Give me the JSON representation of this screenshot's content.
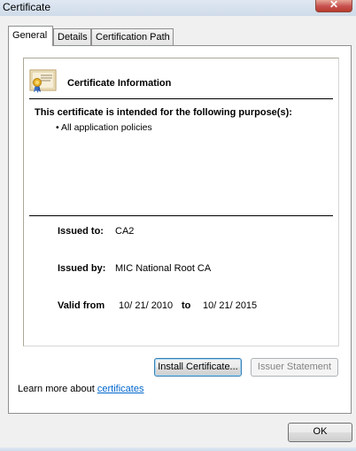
{
  "window": {
    "title": "Certificate",
    "close_symbol": "✕"
  },
  "tabs": [
    {
      "label": "General",
      "active": true
    },
    {
      "label": "Details",
      "active": false
    },
    {
      "label": "Certification Path",
      "active": false
    }
  ],
  "info": {
    "icon": "certificate-icon",
    "title": "Certificate Information",
    "purpose_heading": "This certificate is intended for the following purpose(s):",
    "purposes": [
      "• All application policies"
    ],
    "issued_to_label": "Issued to:",
    "issued_to": "CA2",
    "issued_by_label": "Issued by:",
    "issued_by": "MIC National Root CA",
    "valid_from_label": "Valid from",
    "valid_from": "10/ 21/ 2010",
    "valid_to_label": "to",
    "valid_to": "10/ 21/ 2015"
  },
  "buttons": {
    "install": "Install Certificate...",
    "issuer_statement": "Issuer Statement",
    "ok": "OK"
  },
  "learn_more": {
    "prefix": "Learn more about ",
    "link": "certificates"
  },
  "colors": {
    "link": "#0066cc",
    "close_button": "#c75050"
  }
}
